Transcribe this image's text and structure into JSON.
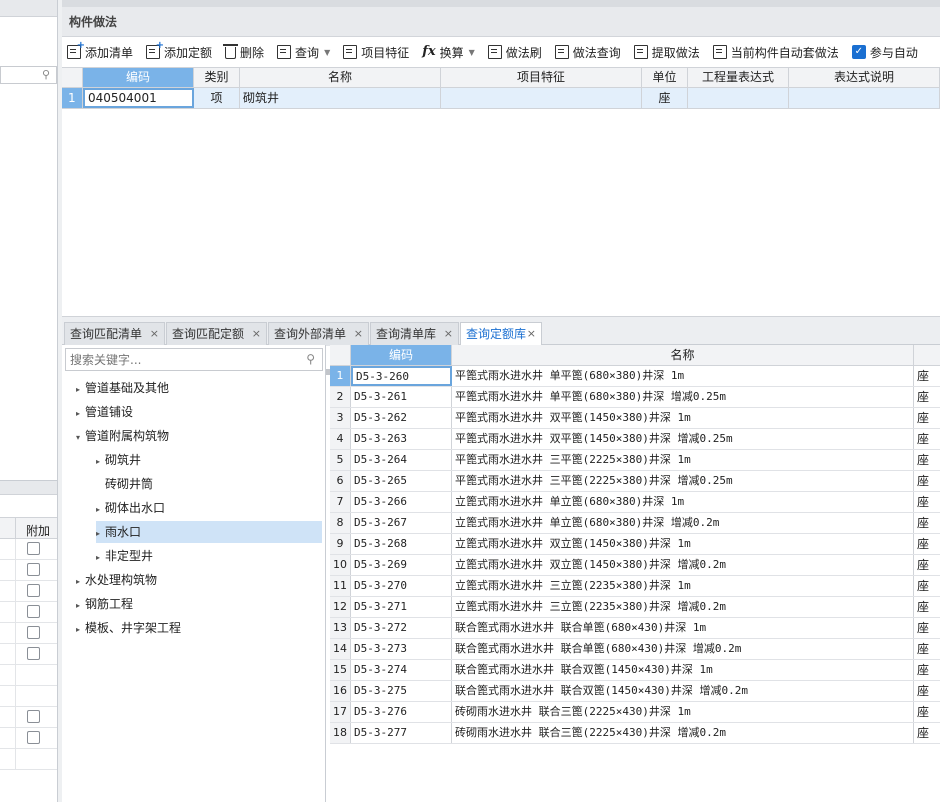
{
  "left_panel": {
    "search_icon": "search-icon",
    "column_header": "附加",
    "checkbox_rows": [
      true,
      true,
      true,
      true,
      true,
      true,
      false,
      false,
      true,
      true,
      false
    ]
  },
  "panel": {
    "title": "构件做法"
  },
  "toolbar": {
    "add_list": "添加清单",
    "add_quota": "添加定额",
    "delete": "删除",
    "query": "查询",
    "item_feature": "项目特征",
    "convert": "换算",
    "method_brush": "做法刷",
    "method_query": "做法查询",
    "extract_method": "提取做法",
    "auto_apply": "当前构件自动套做法",
    "participate_auto": "参与自动"
  },
  "upper_grid": {
    "headers": {
      "code": "编码",
      "category": "类别",
      "name": "名称",
      "feature": "项目特征",
      "unit": "单位",
      "expression": "工程量表达式",
      "expression_desc": "表达式说明"
    },
    "rows": [
      {
        "num": "1",
        "code": "040504001",
        "category": "项",
        "name": "砌筑井",
        "feature": "",
        "unit": "座",
        "expression": "",
        "expression_desc": ""
      }
    ]
  },
  "tabs": [
    {
      "label": "查询匹配清单",
      "close": "×"
    },
    {
      "label": "查询匹配定额",
      "close": "×"
    },
    {
      "label": "查询外部清单",
      "close": "×"
    },
    {
      "label": "查询清单库",
      "close": "×"
    },
    {
      "label": "查询定额库",
      "close": "×",
      "active": true
    }
  ],
  "tree": {
    "search_placeholder": "搜索关键字...",
    "items": [
      {
        "label": "管道基础及其他",
        "arrow": "▸",
        "level": 0
      },
      {
        "label": "管道铺设",
        "arrow": "▸",
        "level": 0
      },
      {
        "label": "管道附属构筑物",
        "arrow": "▾",
        "level": 0
      },
      {
        "label": "砌筑井",
        "arrow": "▸",
        "level": 1
      },
      {
        "label": "砖砌井筒",
        "arrow": "",
        "level": 1
      },
      {
        "label": "砌体出水口",
        "arrow": "▸",
        "level": 1
      },
      {
        "label": "雨水口",
        "arrow": "▸",
        "level": 1,
        "selected": true
      },
      {
        "label": "非定型井",
        "arrow": "▸",
        "level": 1
      },
      {
        "label": "水处理构筑物",
        "arrow": "▸",
        "level": 0
      },
      {
        "label": "钢筋工程",
        "arrow": "▸",
        "level": 0
      },
      {
        "label": "模板、井字架工程",
        "arrow": "▸",
        "level": 0
      }
    ]
  },
  "lower_grid": {
    "headers": {
      "code": "编码",
      "name": "名称"
    },
    "rows": [
      {
        "num": "1",
        "code": "D5-3-260",
        "name": "平篦式雨水进水井 单平篦(680×380)井深 1m",
        "unit": "座"
      },
      {
        "num": "2",
        "code": "D5-3-261",
        "name": "平篦式雨水进水井 单平篦(680×380)井深 增减0.25m",
        "unit": "座"
      },
      {
        "num": "3",
        "code": "D5-3-262",
        "name": "平篦式雨水进水井 双平篦(1450×380)井深 1m",
        "unit": "座"
      },
      {
        "num": "4",
        "code": "D5-3-263",
        "name": "平篦式雨水进水井 双平篦(1450×380)井深 增减0.25m",
        "unit": "座"
      },
      {
        "num": "5",
        "code": "D5-3-264",
        "name": "平篦式雨水进水井 三平篦(2225×380)井深 1m",
        "unit": "座"
      },
      {
        "num": "6",
        "code": "D5-3-265",
        "name": "平篦式雨水进水井 三平篦(2225×380)井深 增减0.25m",
        "unit": "座"
      },
      {
        "num": "7",
        "code": "D5-3-266",
        "name": "立篦式雨水进水井 单立篦(680×380)井深 1m",
        "unit": "座"
      },
      {
        "num": "8",
        "code": "D5-3-267",
        "name": "立篦式雨水进水井 单立篦(680×380)井深 增减0.2m",
        "unit": "座"
      },
      {
        "num": "9",
        "code": "D5-3-268",
        "name": "立篦式雨水进水井 双立篦(1450×380)井深 1m",
        "unit": "座"
      },
      {
        "num": "10",
        "code": "D5-3-269",
        "name": "立篦式雨水进水井 双立篦(1450×380)井深 增减0.2m",
        "unit": "座"
      },
      {
        "num": "11",
        "code": "D5-3-270",
        "name": "立篦式雨水进水井 三立篦(2235×380)井深 1m",
        "unit": "座"
      },
      {
        "num": "12",
        "code": "D5-3-271",
        "name": "立篦式雨水进水井 三立篦(2235×380)井深 增减0.2m",
        "unit": "座"
      },
      {
        "num": "13",
        "code": "D5-3-272",
        "name": "联合篦式雨水进水井 联合单篦(680×430)井深 1m",
        "unit": "座"
      },
      {
        "num": "14",
        "code": "D5-3-273",
        "name": "联合篦式雨水进水井 联合单篦(680×430)井深 增减0.2m",
        "unit": "座"
      },
      {
        "num": "15",
        "code": "D5-3-274",
        "name": "联合篦式雨水进水井 联合双篦(1450×430)井深 1m",
        "unit": "座"
      },
      {
        "num": "16",
        "code": "D5-3-275",
        "name": "联合篦式雨水进水井 联合双篦(1450×430)井深 增减0.2m",
        "unit": "座"
      },
      {
        "num": "17",
        "code": "D5-3-276",
        "name": "砖砌雨水进水井 联合三篦(2225×430)井深 1m",
        "unit": "座"
      },
      {
        "num": "18",
        "code": "D5-3-277",
        "name": "砖砌雨水进水井 联合三篦(2225×430)井深 增减0.2m",
        "unit": "座"
      }
    ]
  },
  "colors": {
    "accent": "#1a6fd1",
    "selected_header": "#7ab3e8",
    "selected_row": "#e3effb",
    "tree_selected": "#cfe3f7"
  }
}
